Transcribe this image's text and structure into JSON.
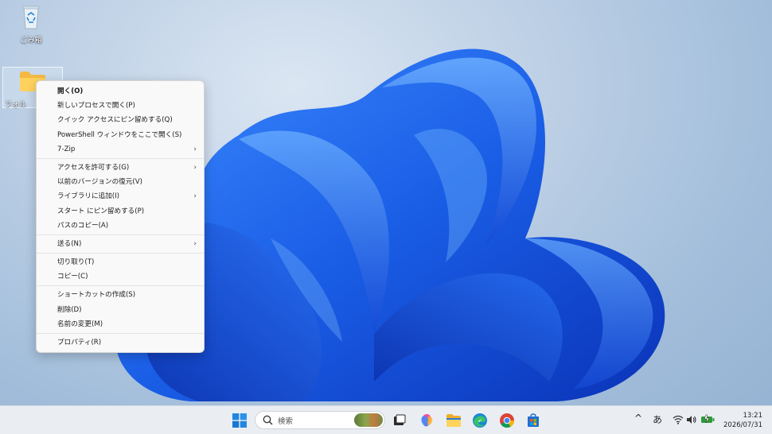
{
  "desktop": {
    "icons": [
      {
        "label": "ごみ箱"
      },
      {
        "label": "フォル"
      }
    ]
  },
  "context_menu": {
    "groups": [
      [
        {
          "label": "開く(O)",
          "bold": true
        },
        {
          "label": "新しいプロセスで開く(P)"
        },
        {
          "label": "クイック アクセスにピン留めする(Q)"
        },
        {
          "label": "PowerShell ウィンドウをここで開く(S)"
        },
        {
          "label": "7-Zip",
          "submenu": true
        }
      ],
      [
        {
          "label": "アクセスを許可する(G)",
          "submenu": true
        },
        {
          "label": "以前のバージョンの復元(V)"
        },
        {
          "label": "ライブラリに追加(I)",
          "submenu": true
        },
        {
          "label": "スタート にピン留めする(P)"
        },
        {
          "label": "パスのコピー(A)"
        }
      ],
      [
        {
          "label": "送る(N)",
          "submenu": true
        }
      ],
      [
        {
          "label": "切り取り(T)"
        },
        {
          "label": "コピー(C)"
        }
      ],
      [
        {
          "label": "ショートカットの作成(S)"
        },
        {
          "label": "削除(D)"
        },
        {
          "label": "名前の変更(M)"
        }
      ],
      [
        {
          "label": "プロパティ(R)"
        }
      ]
    ],
    "submenu_glyph": "›"
  },
  "taskbar": {
    "search_placeholder": "検索",
    "tray": {
      "chevron": "^",
      "ime": "あ"
    },
    "clock": {
      "time": "13:21",
      "date": "2026/07/31"
    }
  },
  "colors": {
    "accent": "#0067c0",
    "bloom": "#1c5fe0"
  }
}
